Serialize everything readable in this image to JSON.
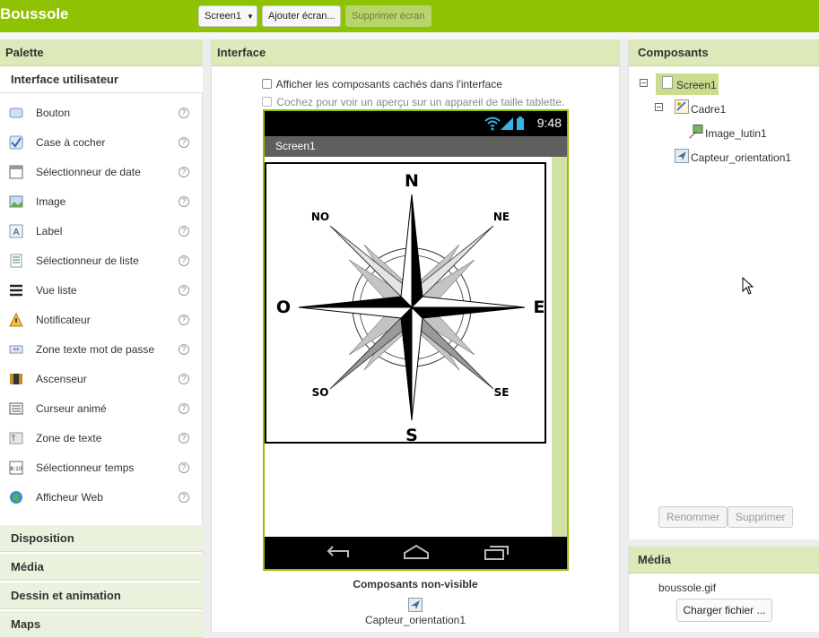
{
  "app_title": "Boussole",
  "toolbar": {
    "screen_select": "Screen1",
    "add_screen": "Ajouter écran...",
    "remove_screen": "Supprimer écran"
  },
  "palette": {
    "title": "Palette",
    "category_ui": "Interface utilisateur",
    "items": [
      {
        "label": "Bouton",
        "icon": "button-icon"
      },
      {
        "label": "Case à cocher",
        "icon": "checkbox-icon"
      },
      {
        "label": "Sélectionneur de date",
        "icon": "date-picker-icon"
      },
      {
        "label": "Image",
        "icon": "image-icon"
      },
      {
        "label": "Label",
        "icon": "label-icon"
      },
      {
        "label": "Sélectionneur de liste",
        "icon": "list-picker-icon"
      },
      {
        "label": "Vue liste",
        "icon": "list-view-icon"
      },
      {
        "label": "Notificateur",
        "icon": "notifier-icon"
      },
      {
        "label": "Zone texte mot de passe",
        "icon": "password-icon"
      },
      {
        "label": "Ascenseur",
        "icon": "slider-icon"
      },
      {
        "label": "Curseur animé",
        "icon": "spinner-icon"
      },
      {
        "label": "Zone de texte",
        "icon": "textbox-icon"
      },
      {
        "label": "Sélectionneur temps",
        "icon": "time-picker-icon"
      },
      {
        "label": "Afficheur Web",
        "icon": "web-viewer-icon"
      }
    ],
    "help_glyph": "?",
    "categories": [
      "Disposition",
      "Média",
      "Dessin et animation",
      "Maps"
    ]
  },
  "viewer": {
    "title": "Interface",
    "show_hidden": "Afficher les composants cachés dans l'interface",
    "tablet_preview": "Cochez pour voir un aperçu sur un appareil de taille tablette.",
    "clock": "9:48",
    "screen_title": "Screen1",
    "compass": {
      "north": "N",
      "south": "S",
      "east": "E",
      "west": "O",
      "ne": "NE",
      "no": "NO",
      "se": "SE",
      "so": "SO"
    },
    "nonvisible_title": "Composants non-visible",
    "nonvisible_item": "Capteur_orientation1"
  },
  "components": {
    "title": "Composants",
    "tree": [
      "Screen1",
      "Cadre1",
      "Image_lutin1",
      "Capteur_orientation1"
    ],
    "rename": "Renommer",
    "delete": "Supprimer"
  },
  "media": {
    "title": "Média",
    "file": "boussole.gif",
    "upload": "Charger fichier ..."
  },
  "colors": {
    "accent": "#8fc202",
    "header_bg": "#dce9b9",
    "selected": "#c9dd8e"
  }
}
